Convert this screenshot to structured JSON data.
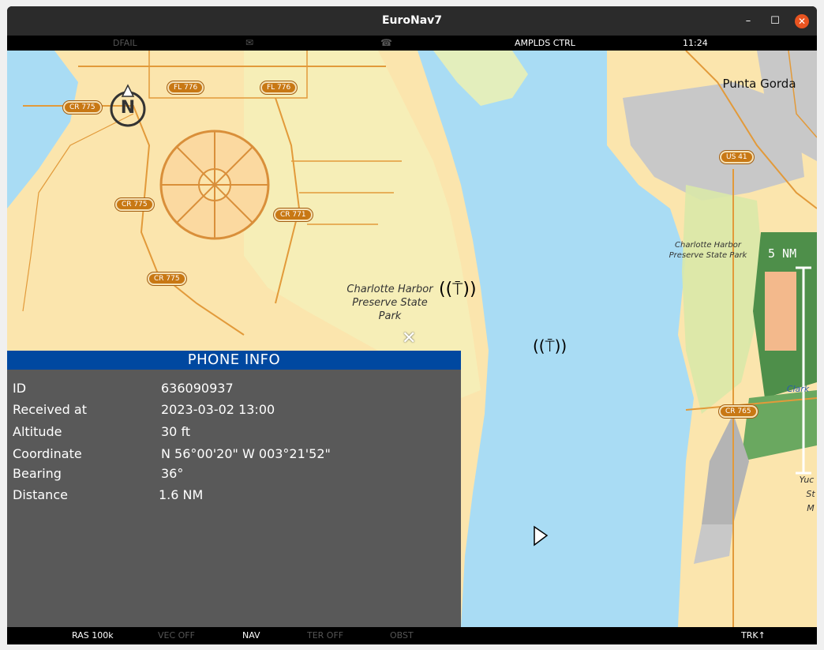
{
  "window": {
    "title": "EuroNav7"
  },
  "topbar": {
    "dfail": "DFAIL",
    "ampl": "AMPLDS CTRL",
    "time": "11:24",
    "mail_icon": "envelope-icon",
    "phone_icon": "phone-icon"
  },
  "map": {
    "labels": {
      "punta_gorda": "Punta Gorda",
      "park_west": "Charlotte Harbor\nPreserve State\nPark",
      "park_east": "Charlotte Harbor\nPreserve State Park",
      "clark": "Clark",
      "yuc": "Yuc",
      "st": "St",
      "m": "M"
    },
    "shields": {
      "fl776a": "FL 776",
      "fl776b": "FL 776",
      "cr775a": "CR 775",
      "cr775b": "CR 775",
      "cr775c": "CR 775",
      "cr771": "CR 771",
      "us41": "US 41",
      "cr765": "CR 765"
    },
    "scale": "5  NM"
  },
  "phone_info": {
    "title": "PHONE INFO",
    "rows": [
      {
        "label": "ID",
        "value": "636090937"
      },
      {
        "label": "Received at",
        "value": "2023-03-02   13:00"
      },
      {
        "label": "Altitude",
        "value": "30 ft"
      },
      {
        "label": "Coordinate",
        "value": "N  56°00'20\" W 003°21'52\""
      },
      {
        "label": "Bearing",
        "value": "36°"
      },
      {
        "label": "Distance",
        "value": "1.6 NM"
      }
    ]
  },
  "bottombar": {
    "ras": "RAS 100k",
    "vec": "VEC OFF",
    "nav": "NAV",
    "ter": "TER OFF",
    "obst": "OBST",
    "trk": "TRK↑"
  },
  "colors": {
    "panel_header": "#0048a0",
    "panel_bg": "#595959",
    "water": "#a9dcf4",
    "land": "#fbe5ad"
  }
}
